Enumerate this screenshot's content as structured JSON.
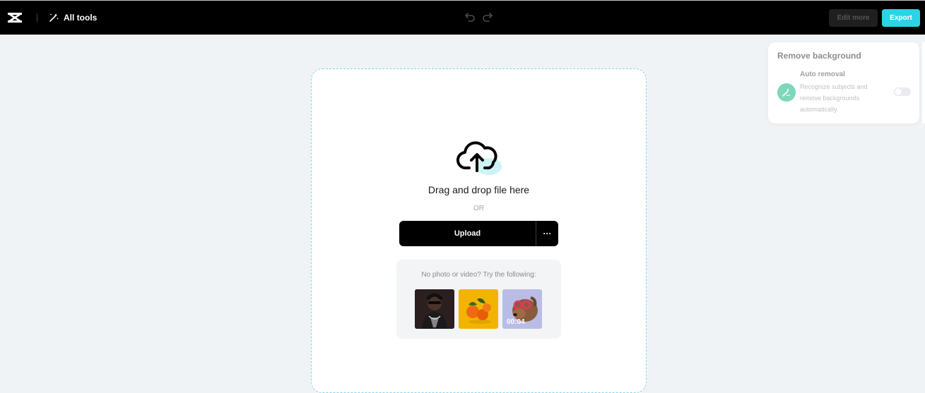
{
  "header": {
    "all_tools_label": "All tools",
    "edit_more_label": "Edit more",
    "export_label": "Export",
    "colors": {
      "bar": "#000000",
      "export": "#2bd4e3"
    }
  },
  "upload": {
    "drag_drop_text": "Drag and drop file here",
    "or_text": "OR",
    "upload_label": "Upload",
    "more_label": "···"
  },
  "samples": {
    "label": "No photo or video? Try the following:",
    "items": [
      {
        "name": "sample-person"
      },
      {
        "name": "sample-oranges"
      },
      {
        "name": "sample-dog-video",
        "duration": "00:04"
      }
    ]
  },
  "panel": {
    "title": "Remove background",
    "option_title": "Auto removal",
    "option_desc": "Recognize subjects and remove backgrounds automatically.",
    "toggle_on": false
  },
  "icons": [
    "capcut-logo-icon",
    "magic-wand-icon",
    "undo-icon",
    "redo-icon",
    "cloud-upload-icon",
    "auto-removal-icon"
  ]
}
